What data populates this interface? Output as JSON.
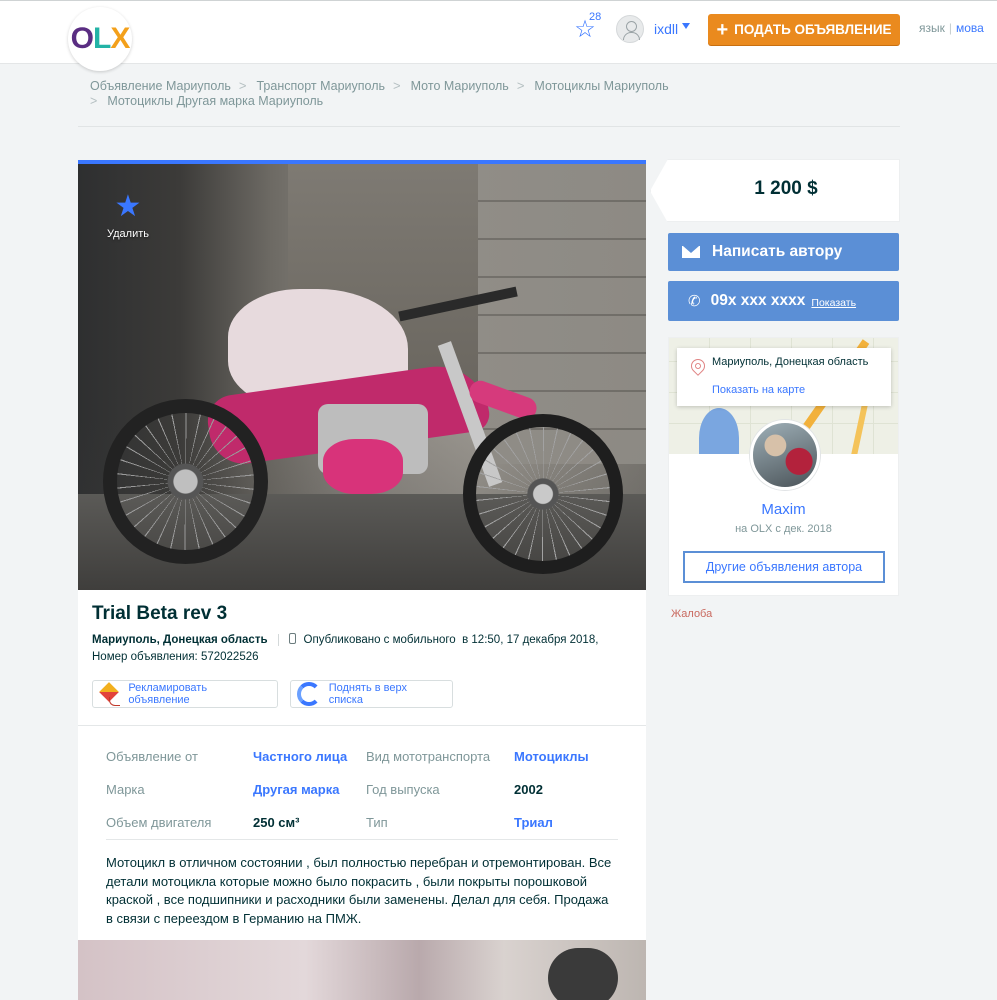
{
  "header": {
    "logo": "OLX",
    "favorites_count": "28",
    "username": "ixdll",
    "post_ad_label": "ПОДАТЬ ОБЪЯВЛЕНИЕ",
    "lang_label": "язык",
    "lang_option": "мова"
  },
  "breadcrumbs": [
    "Объявление Мариуполь",
    "Транспорт Мариуполь",
    "Мото Мариуполь",
    "Мотоциклы Мариуполь",
    "Мотоциклы Другая марка Мариуполь"
  ],
  "ad": {
    "favorite_label": "Удалить",
    "title": "Trial Beta rev 3",
    "location": "Мариуполь, Донецкая область",
    "published_via": "Опубликовано с мобильного",
    "published_at": "в 12:50, 17 декабря 2018,",
    "ad_number": "Номер объявления: 572022526",
    "promote_label": "Рекламировать объявление",
    "raise_label": "Поднять в верх списка",
    "params": [
      {
        "key": "Объявление от",
        "value": "Частного лица",
        "link": true
      },
      {
        "key": "Вид мототранспорта",
        "value": "Мотоциклы",
        "link": true
      },
      {
        "key": "Марка",
        "value": "Другая марка",
        "link": true
      },
      {
        "key": "Год выпуска",
        "value": "2002",
        "link": false
      },
      {
        "key": "Объем двигателя",
        "value": "250 см³",
        "link": false
      },
      {
        "key": "Тип",
        "value": "Триал",
        "link": true
      }
    ],
    "description": "Мотоцикл в отличном состоянии , был полностью перебран и отремонтирован. Все детали мотоцикла которые можно было покрасить , были покрыты порошковой краской , все подшипники и расходники были заменены. Делал для себя. Продажа в связи с переездом в Германию на ПМЖ."
  },
  "sidebar": {
    "price": "1 200 $",
    "message_label": "Написать автору",
    "phone_masked": "09x xxx xxxx",
    "phone_show_label": "Показать",
    "location_city": "Мариуполь, Донецкая область",
    "show_on_map_label": "Показать на карте",
    "seller_name": "Maxim",
    "seller_since": "на OLX с дек. 2018",
    "other_ads_label": "Другие объявления автора",
    "complaint_label": "Жалоба"
  },
  "colors": {
    "accent": "#3a77ff",
    "button_blue": "#5b8fd6",
    "orange": "#ea8a1e"
  }
}
